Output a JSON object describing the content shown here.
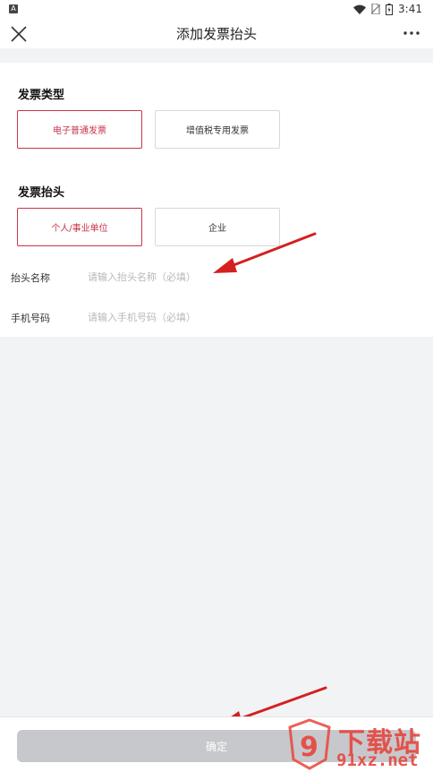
{
  "status_bar": {
    "app_badge": "A",
    "time": "3:41",
    "icons": [
      "wifi-icon",
      "no-sim-icon",
      "battery-charging-icon"
    ]
  },
  "nav": {
    "title": "添加发票抬头",
    "left_icon": "close-icon",
    "right_icon": "more-icon"
  },
  "invoice_type": {
    "title": "发票类型",
    "options": [
      {
        "label": "电子普通发票",
        "selected": true
      },
      {
        "label": "增值税专用发票",
        "selected": false
      }
    ]
  },
  "invoice_header": {
    "title": "发票抬头",
    "options": [
      {
        "label": "个人/事业单位",
        "selected": true
      },
      {
        "label": "企业",
        "selected": false
      }
    ]
  },
  "fields": {
    "header_name": {
      "label": "抬头名称",
      "value": "",
      "placeholder": "请输入抬头名称（必填）"
    },
    "phone": {
      "label": "手机号码",
      "value": "",
      "placeholder": "请输入手机号码（必填）"
    }
  },
  "confirm_label": "确定",
  "colors": {
    "accent": "#c8344a",
    "button_disabled": "#c7c8cc",
    "background": "#f2f3f5",
    "arrow": "#d42020"
  },
  "watermark": {
    "text_top": "下载站",
    "text_bottom": "91xz.net",
    "logo_glyph": "9"
  }
}
